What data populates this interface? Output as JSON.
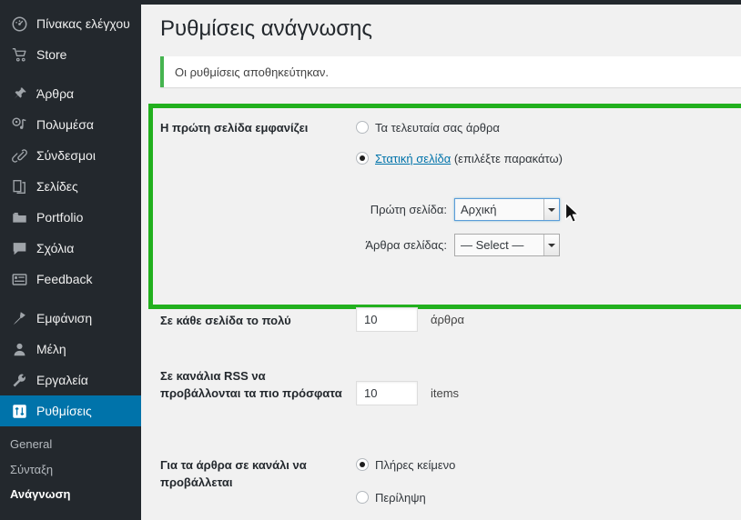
{
  "sidebar": {
    "items": [
      {
        "label": "Πίνακας ελέγχου",
        "icon": "dashboard-icon",
        "active": false
      },
      {
        "label": "Store",
        "icon": "cart-icon",
        "active": false
      },
      {
        "label": "Άρθρα",
        "icon": "pin-icon",
        "active": false
      },
      {
        "label": "Πολυμέσα",
        "icon": "media-icon",
        "active": false
      },
      {
        "label": "Σύνδεσμοι",
        "icon": "link-icon",
        "active": false
      },
      {
        "label": "Σελίδες",
        "icon": "pages-icon",
        "active": false
      },
      {
        "label": "Portfolio",
        "icon": "portfolio-icon",
        "active": false
      },
      {
        "label": "Σχόλια",
        "icon": "comment-icon",
        "active": false
      },
      {
        "label": "Feedback",
        "icon": "feedback-icon",
        "active": false
      },
      {
        "label": "Εμφάνιση",
        "icon": "appearance-icon",
        "active": false
      },
      {
        "label": "Μέλη",
        "icon": "users-icon",
        "active": false
      },
      {
        "label": "Εργαλεία",
        "icon": "tools-icon",
        "active": false
      },
      {
        "label": "Ρυθμίσεις",
        "icon": "settings-icon",
        "active": true
      }
    ],
    "submenu": [
      {
        "label": "General",
        "current": false
      },
      {
        "label": "Σύνταξη",
        "current": false
      },
      {
        "label": "Ανάγνωση",
        "current": true
      }
    ]
  },
  "page": {
    "title": "Ρυθμίσεις ανάγνωσης",
    "notice": "Οι ρυθμίσεις αποθηκεύτηκαν."
  },
  "front_page": {
    "label": "Η πρώτη σελίδα εμφανίζει",
    "option_posts": "Τα τελευταία σας άρθρα",
    "option_static_link": "Στατική σελίδα",
    "option_static_suffix": " (επιλέξτε παρακάτω)",
    "selected": "static",
    "front_select_label": "Πρώτη σελίδα:",
    "front_select_value": "Αρχική",
    "posts_select_label": "Άρθρα σελίδας:",
    "posts_select_value": "— Select —"
  },
  "per_page": {
    "label": "Σε κάθε σελίδα το πολύ",
    "value": "10",
    "unit": "άρθρα"
  },
  "rss_items": {
    "label": "Σε κανάλια RSS να προβάλλονται τα πιο πρόσφατα",
    "value": "10",
    "unit": "items"
  },
  "feed_show": {
    "label": "Για τα άρθρα σε κανάλι να προβάλλεται",
    "option_full": "Πλήρες κείμενο",
    "option_summary": "Περίληψη",
    "selected": "full"
  },
  "colors": {
    "sidebar_bg": "#23282d",
    "accent_blue": "#0073aa",
    "notice_green": "#46b450",
    "highlight_green": "#22b01e",
    "link_blue": "#0073aa"
  }
}
